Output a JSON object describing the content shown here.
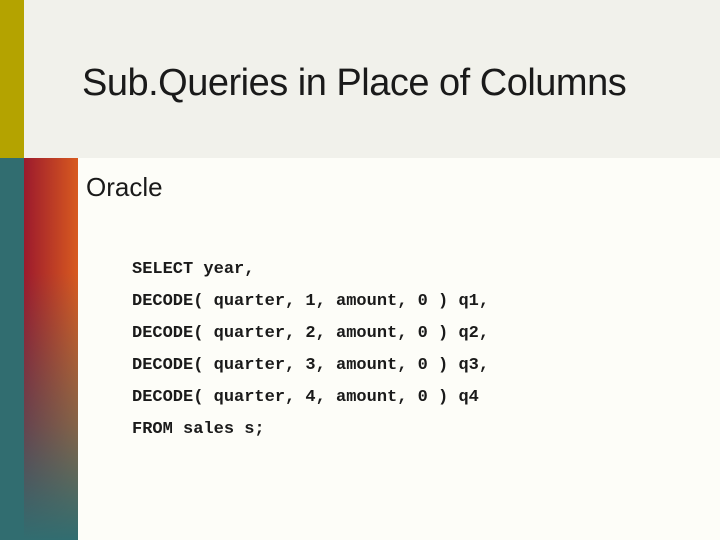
{
  "slide": {
    "title": "Sub.Queries in Place of Columns",
    "subtitle": "Oracle",
    "code": {
      "line1": "SELECT year,",
      "line2": "DECODE( quarter, 1, amount, 0 ) q1,",
      "line3": "DECODE( quarter, 2, amount, 0 ) q2,",
      "line4": "DECODE( quarter, 3, amount, 0 ) q3,",
      "line5": "DECODE( quarter, 4, amount, 0 ) q4",
      "line6": "FROM sales s;"
    }
  },
  "colors": {
    "background_teal": "#316d70",
    "top_band": "#f1f1eb",
    "content_panel": "#fdfdf8",
    "accent_olive": "#b4a300",
    "gradient_left": "#9c1a2d",
    "gradient_right": "#d85a1f"
  }
}
